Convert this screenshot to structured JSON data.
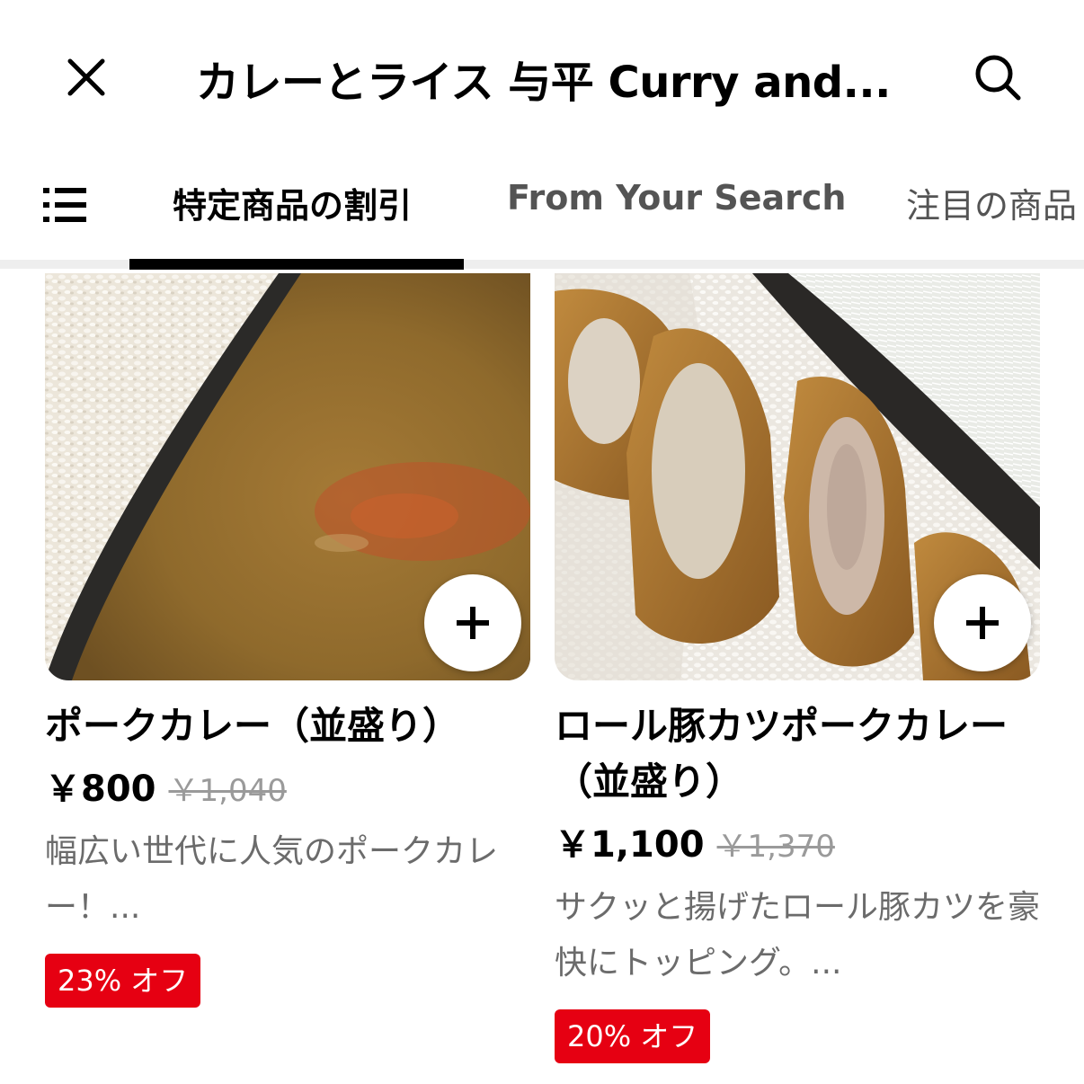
{
  "header": {
    "title": "カレーとライス 与平 Curry and...",
    "close_icon": "close-icon",
    "search_icon": "search-icon"
  },
  "tabs": {
    "menu_icon": "list-icon",
    "items": [
      {
        "label": "特定商品の割引",
        "active": true
      },
      {
        "label": "From Your Search",
        "active": false
      },
      {
        "label": "注目の商品",
        "active": false
      }
    ]
  },
  "items": [
    {
      "name": "ポークカレー（並盛り）",
      "price": "￥800",
      "original_price": "￥1,040",
      "description": "幅広い世代に人気のポークカレー！...",
      "badge": "23% オフ",
      "add_icon": "plus-icon"
    },
    {
      "name": "ロール豚カツポークカレー（並盛り）",
      "price": "￥1,100",
      "original_price": "￥1,370",
      "description": "サクッと揚げたロール豚カツを豪快にトッピング。...",
      "badge": "20% オフ",
      "add_icon": "plus-icon"
    }
  ],
  "colors": {
    "badge": "#e60012",
    "tab_active": "#000000",
    "tab_inactive": "#545454"
  }
}
